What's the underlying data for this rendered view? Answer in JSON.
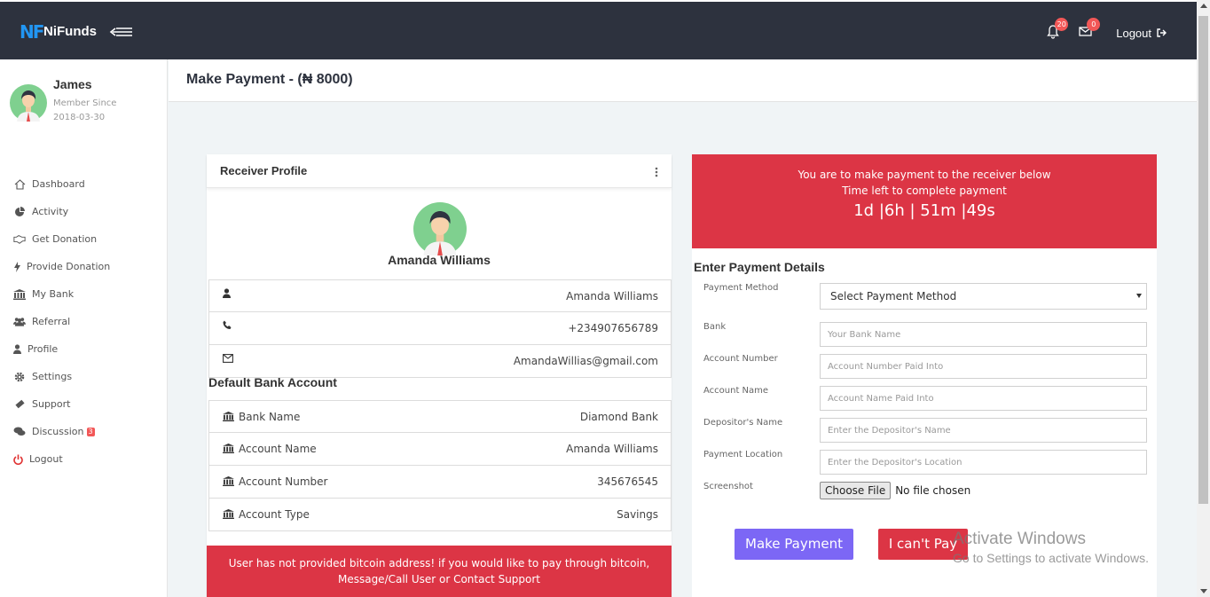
{
  "app": {
    "brand_mark": "NF",
    "brand_name": "NiFunds"
  },
  "topbar": {
    "notifications_count": "20",
    "messages_count": "0",
    "logout_label": "Logout"
  },
  "user": {
    "name": "James",
    "member_since_label": "Member Since",
    "member_since_date": "2018-03-30"
  },
  "sidebar": {
    "items": [
      {
        "label": "Dashboard",
        "icon": "home-icon"
      },
      {
        "label": "Activity",
        "icon": "pie-chart-icon"
      },
      {
        "label": "Get Donation",
        "icon": "handshake-icon"
      },
      {
        "label": "Provide Donation",
        "icon": "bolt-icon"
      },
      {
        "label": "My Bank",
        "icon": "bank-icon"
      },
      {
        "label": "Referral",
        "icon": "users-icon"
      },
      {
        "label": "Profile",
        "icon": "user-icon"
      },
      {
        "label": "Settings",
        "icon": "gear-icon"
      },
      {
        "label": "Support",
        "icon": "ticket-icon"
      },
      {
        "label": "Discussion",
        "icon": "comments-icon",
        "badge": "3"
      },
      {
        "label": "Logout",
        "icon": "power-icon"
      }
    ]
  },
  "page": {
    "title": "Make Payment - (₦ 8000)"
  },
  "receiver": {
    "card_title": "Receiver Profile",
    "name": "Amanda Williams",
    "full_name": "Amanda Williams",
    "phone": "+234907656789",
    "email": "AmandaWillias@gmail.com",
    "bank_section_title": "Default Bank Account",
    "bank": {
      "bank_name_label": "Bank Name",
      "bank_name": "Diamond Bank",
      "account_name_label": "Account Name",
      "account_name": "Amanda Williams",
      "account_number_label": "Account Number",
      "account_number": "345676545",
      "account_type_label": "Account Type",
      "account_type": "Savings"
    },
    "bitcoin_alert_line1": "User has not provided bitcoin address! if you would like to pay through bitcoin,",
    "bitcoin_alert_line2": "Message/Call User or Contact Support"
  },
  "payment": {
    "alert_line1": "You are to make payment to the receiver below",
    "alert_line2": "Time left to complete payment",
    "timer": "1d |6h | 51m |49s",
    "form_title": "Enter Payment Details",
    "method_label": "Payment Method",
    "method_selected": "Select Payment Method",
    "bank_label": "Bank",
    "bank_placeholder": "Your Bank Name",
    "account_number_label": "Account Number",
    "account_number_placeholder": "Account Number Paid Into",
    "account_name_label": "Account Name",
    "account_name_placeholder": "Account Name Paid Into",
    "depositor_label": "Depositor's Name",
    "depositor_placeholder": "Enter the Depositor's Name",
    "location_label": "Payment Location",
    "location_placeholder": "Enter the Depositor's Location",
    "screenshot_label": "Screenshot",
    "choose_file_label": "Choose File",
    "no_file_label": "No file chosen",
    "make_payment_label": "Make Payment",
    "cant_pay_label": "I can't Pay"
  },
  "watermark": {
    "line1": "Activate Windows",
    "line2": "Go to Settings to activate Windows."
  },
  "colors": {
    "topbar": "#2d323e",
    "danger": "#dc3545",
    "primary": "#7c67f5",
    "brand_blue": "#2196f3"
  }
}
